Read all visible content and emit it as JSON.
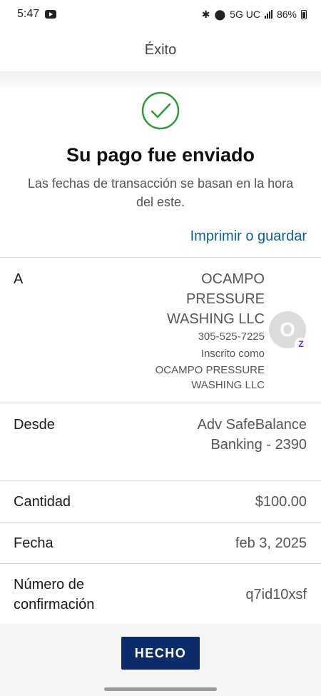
{
  "status_bar": {
    "time": "5:47",
    "network": "5G UC",
    "battery": "86%"
  },
  "header": {
    "title": "Éxito"
  },
  "success": {
    "title": "Su pago fue enviado",
    "subtitle": "Las fechas de transacción se basan en la hora del este."
  },
  "print_link": "Imprimir o guardar",
  "details": {
    "to": {
      "label": "A",
      "name": "OCAMPO PRESSURE WASHING LLC",
      "phone": "305-525-7225",
      "enrolled_label": "Inscrito como",
      "enrolled_name": "OCAMPO PRESSURE WASHING LLC",
      "avatar_initial": "O",
      "badge": "Z"
    },
    "from": {
      "label": "Desde",
      "value": "Adv SafeBalance Banking - 2390"
    },
    "amount": {
      "label": "Cantidad",
      "value": "$100.00"
    },
    "date": {
      "label": "Fecha",
      "value": "feb 3, 2025"
    },
    "confirmation": {
      "label": "Número de confirmación",
      "value": "q7id10xsf"
    }
  },
  "done_button": "HECHO",
  "colors": {
    "accent": "#0c2b6b",
    "link": "#0e5aa7",
    "success": "#2e9a3a",
    "zelle": "#6d1ed4"
  }
}
